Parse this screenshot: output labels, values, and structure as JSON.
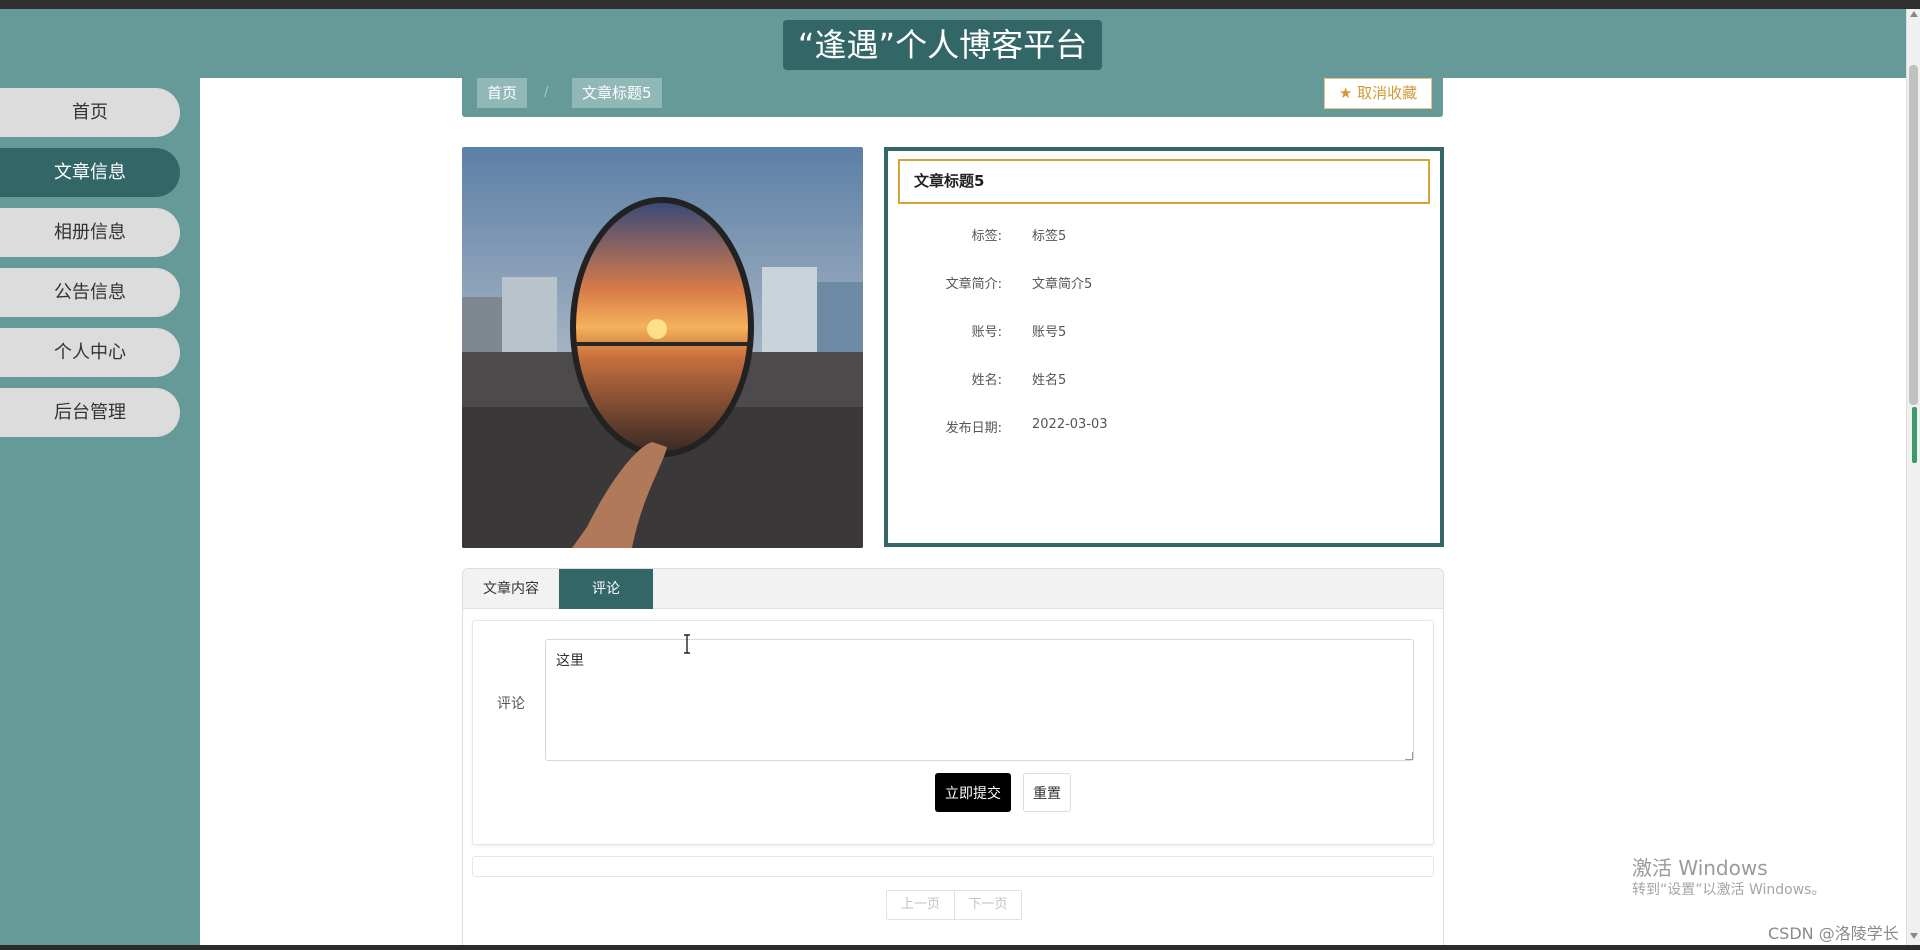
{
  "header": {
    "site_title": "“逢遇”个人博客平台"
  },
  "sidebar": {
    "items": [
      {
        "label": "首页",
        "active": false
      },
      {
        "label": "文章信息",
        "active": true
      },
      {
        "label": "相册信息",
        "active": false
      },
      {
        "label": "公告信息",
        "active": false
      },
      {
        "label": "个人中心",
        "active": false
      },
      {
        "label": "后台管理",
        "active": false
      }
    ]
  },
  "breadcrumb": {
    "home": "首页",
    "current": "文章标题5",
    "separator": "/"
  },
  "favorite_button": {
    "icon": "star-icon",
    "label": "取消收藏"
  },
  "article": {
    "title": "文章标题5",
    "fields": [
      {
        "label": "标签:",
        "value": "标签5"
      },
      {
        "label": "文章简介:",
        "value": "文章简介5"
      },
      {
        "label": "账号:",
        "value": "账号5"
      },
      {
        "label": "姓名:",
        "value": "姓名5"
      },
      {
        "label": "发布日期:",
        "value": "2022-03-03"
      }
    ]
  },
  "tabs": [
    {
      "label": "文章内容",
      "active": false
    },
    {
      "label": "评论",
      "active": true
    }
  ],
  "comment_form": {
    "label": "评论",
    "value": "这里",
    "submit_label": "立即提交",
    "reset_label": "重置"
  },
  "pagination": {
    "prev": "上一页",
    "next": "下一页"
  },
  "overlay": {
    "activate_title": "激活 Windows",
    "activate_hint": "转到“设置”以激活 Windows。",
    "csdn_watermark": "CSDN @洛陵学长"
  },
  "colors": {
    "primary": "#336666",
    "secondary": "#669a99",
    "accent": "#d6a23a"
  }
}
